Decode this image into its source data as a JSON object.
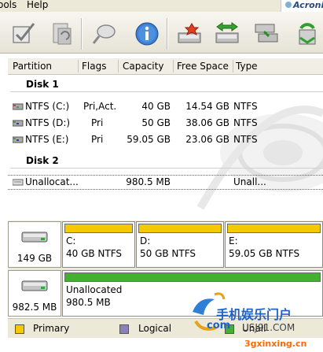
{
  "menubar": {
    "tools_label": "ools",
    "help_label": "Help",
    "brand": "Acronis"
  },
  "table": {
    "headers": [
      "Partition",
      "Flags",
      "Capacity",
      "Free Space",
      "Type"
    ],
    "disks": [
      {
        "label": "Disk 1",
        "rows": [
          {
            "partition": "NTFS (C:)",
            "flags": "Pri,Act.",
            "capacity": "40 GB",
            "free": "14.54 GB",
            "type": "NTFS"
          },
          {
            "partition": "NTFS (D:)",
            "flags": "Pri",
            "capacity": "50 GB",
            "free": "38.06 GB",
            "type": "NTFS"
          },
          {
            "partition": "NTFS (E:)",
            "flags": "Pri",
            "capacity": "59.05 GB",
            "free": "23.06 GB",
            "type": "NTFS"
          }
        ]
      },
      {
        "label": "Disk 2",
        "rows": [
          {
            "partition": "Unallocat...",
            "flags": "",
            "capacity": "980.5 MB",
            "free": "",
            "type": "Unall..."
          }
        ]
      }
    ]
  },
  "diskmap": {
    "disk1": {
      "size": "149 GB",
      "parts": [
        {
          "letter": "C:",
          "desc": "40 GB  NTFS"
        },
        {
          "letter": "D:",
          "desc": "50 GB  NTFS"
        },
        {
          "letter": "E:",
          "desc": "59.05 GB  NTFS"
        }
      ]
    },
    "disk2": {
      "size": "982.5 MB",
      "part": {
        "name": "Unallocated",
        "desc": "980.5 MB"
      }
    }
  },
  "legend": {
    "primary": "Primary",
    "logical": "Logical",
    "unallocated": "Unall"
  },
  "overlay": {
    "brand_cn": "手机娱乐门户",
    "brand_domain": "com",
    "brand_site": "USJ91.COM",
    "url": "3gxinxing.cn"
  },
  "colors": {
    "primary": "#f5c800",
    "logical": "#8a82b8",
    "unallocated": "#44b030"
  }
}
